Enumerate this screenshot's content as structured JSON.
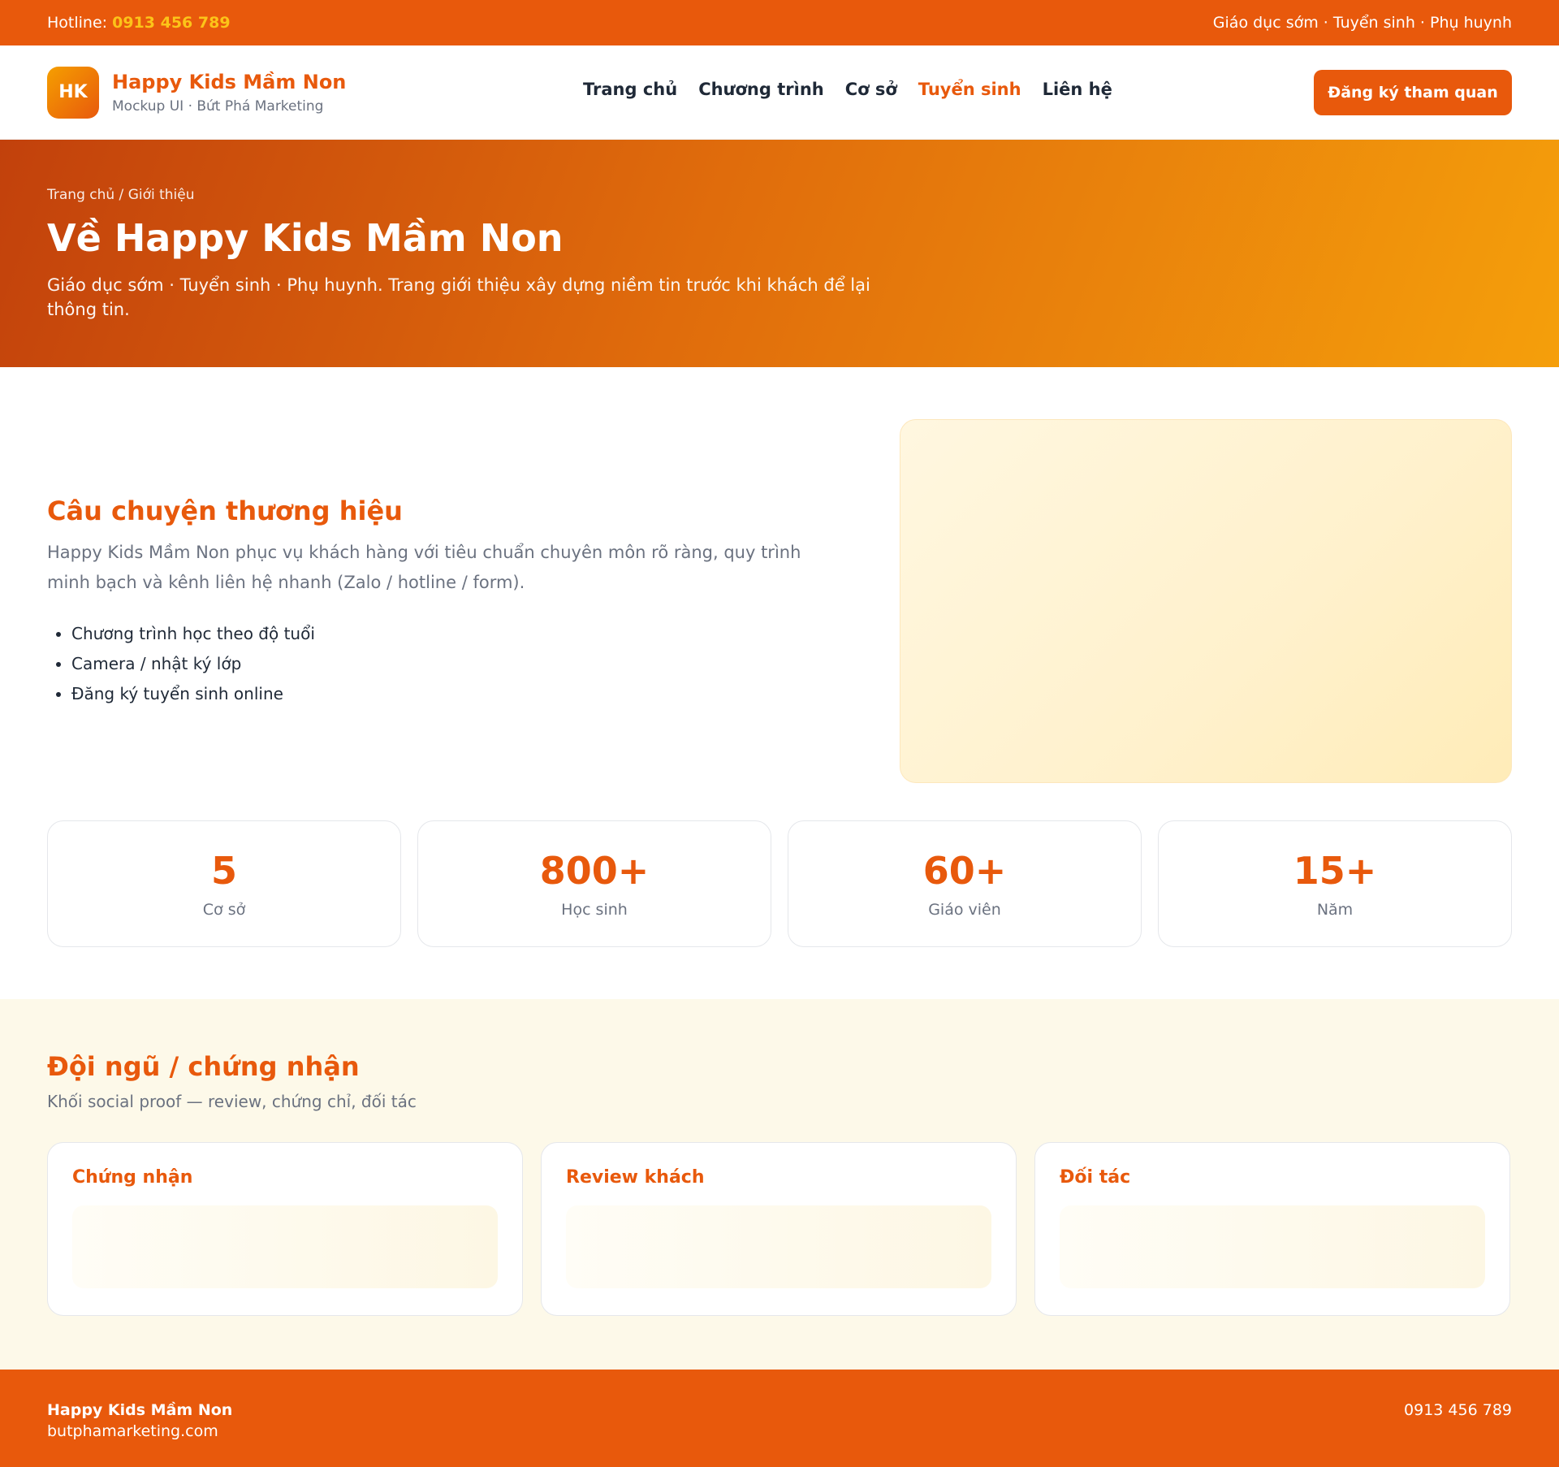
{
  "topbar": {
    "hotline_label": "Hotline:",
    "hotline_number": "0913 456 789",
    "tagline": "Giáo dục sớm · Tuyển sinh · Phụ huynh"
  },
  "header": {
    "logo_text": "HK",
    "brand_name": "Happy Kids Mầm Non",
    "brand_sub": "Mockup UI · Bứt Phá Marketing",
    "nav": [
      {
        "label": "Trang chủ"
      },
      {
        "label": "Chương trình"
      },
      {
        "label": "Cơ sở"
      },
      {
        "label": "Tuyển sinh",
        "active": true
      },
      {
        "label": "Liên hệ"
      }
    ],
    "cta_label": "Đăng ký tham quan"
  },
  "hero": {
    "breadcrumb": "Trang chủ / Giới thiệu",
    "title": "Về Happy Kids Mầm Non",
    "subtitle": "Giáo dục sớm · Tuyển sinh · Phụ huynh. Trang giới thiệu xây dựng niềm tin trước khi khách để lại thông tin."
  },
  "story": {
    "title": "Câu chuyện thương hiệu",
    "description": "Happy Kids Mầm Non phục vụ khách hàng với tiêu chuẩn chuyên môn rõ ràng, quy trình minh bạch và kênh liên hệ nhanh (Zalo / hotline / form).",
    "bullets": [
      "Chương trình học theo độ tuổi",
      "Camera / nhật ký lớp",
      "Đăng ký tuyển sinh online"
    ]
  },
  "stats": [
    {
      "value": "5",
      "label": "Cơ sở"
    },
    {
      "value": "800+",
      "label": "Học sinh"
    },
    {
      "value": "60+",
      "label": "Giáo viên"
    },
    {
      "value": "15+",
      "label": "Năm"
    }
  ],
  "team": {
    "title": "Đội ngũ / chứng nhận",
    "subtitle": "Khối social proof — review, chứng chỉ, đối tác",
    "cards": [
      {
        "title": "Chứng nhận"
      },
      {
        "title": "Review khách"
      },
      {
        "title": "Đối tác"
      }
    ]
  },
  "footer": {
    "name": "Happy Kids Mầm Non",
    "site": "butphamarketing.com",
    "phone": "0913 456 789"
  },
  "colors": {
    "brand": "#e8590c",
    "accent": "#fcc419",
    "team_bg": "#fdf9e9"
  }
}
